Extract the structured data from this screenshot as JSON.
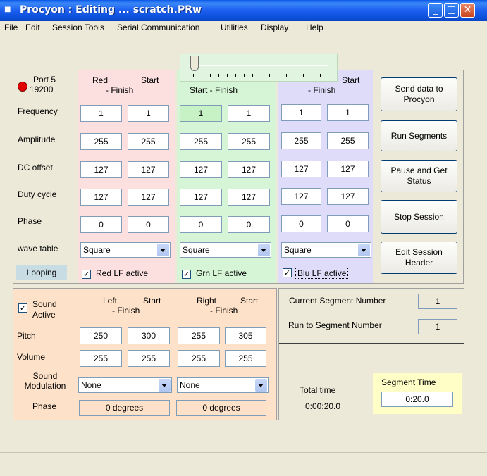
{
  "window": {
    "title": "Procyon : Editing ... scratch.PRw"
  },
  "menu": [
    "File",
    "Edit",
    "Session Tools",
    "Serial Communication",
    "Utilities",
    "Display",
    "Help"
  ],
  "colors": {
    "red": "#fce0e0",
    "green": "#d6f5d6",
    "blue": "#dedcf8",
    "orange": "#fde1c8",
    "yellow": "#fefec6",
    "looping": "#c8dce4",
    "titlebar": "#0a58e6"
  },
  "port": {
    "name": "Port 5",
    "baud": "19200"
  },
  "rows": {
    "frequency": "Frequency",
    "amplitude": "Amplitude",
    "dc_offset": "DC offset",
    "duty_cycle": "Duty cycle",
    "phase": "Phase",
    "wave_table": "wave table",
    "looping": "Looping"
  },
  "red": {
    "title": "Red",
    "start": "Start",
    "finish": "- Finish",
    "frequency": [
      "1",
      "1"
    ],
    "amplitude": [
      "255",
      "255"
    ],
    "dc_offset": [
      "127",
      "127"
    ],
    "duty_cycle": [
      "127",
      "127"
    ],
    "phase": [
      "0",
      "0"
    ],
    "wave": "Square",
    "lf_label": "Red LF active"
  },
  "green": {
    "header": "Start  -  Finish",
    "frequency": [
      "1",
      "1"
    ],
    "amplitude": [
      "255",
      "255"
    ],
    "dc_offset": [
      "127",
      "127"
    ],
    "duty_cycle": [
      "127",
      "127"
    ],
    "phase": [
      "0",
      "0"
    ],
    "wave": "Square",
    "lf_label": "Grn LF active"
  },
  "blue": {
    "start": "Start",
    "finish": "- Finish",
    "frequency": [
      "1",
      "1"
    ],
    "amplitude": [
      "255",
      "255"
    ],
    "dc_offset": [
      "127",
      "127"
    ],
    "duty_cycle": [
      "127",
      "127"
    ],
    "phase": [
      "0",
      "0"
    ],
    "wave": "Square",
    "lf_label": "Blu LF active"
  },
  "buttons": {
    "send": "Send data to Procyon",
    "run": "Run Segments",
    "pause": "Pause and Get Status",
    "stop": "Stop Session",
    "edit": "Edit Session Header"
  },
  "sound": {
    "active_label": "Sound Active",
    "left": "Left",
    "right": "Right",
    "start": "Start",
    "finish": "- Finish",
    "pitch_label": "Pitch",
    "volume_label": "Volume",
    "modulation_label": "Sound Modulation",
    "phase_label": "Phase",
    "left_pitch": [
      "250",
      "300"
    ],
    "right_pitch": [
      "255",
      "305"
    ],
    "left_volume": [
      "255",
      "255"
    ],
    "right_volume": [
      "255",
      "255"
    ],
    "left_mod": "None",
    "right_mod": "None",
    "left_phase": "0 degrees",
    "right_phase": "0 degrees"
  },
  "segment": {
    "current_label": "Current Segment Number",
    "current": "1",
    "run_to_label": "Run to Segment Number",
    "run_to": "1",
    "total_time_label": "Total time",
    "total_time": "0:00:20.0",
    "segment_time_label": "Segment Time",
    "segment_time": "0:20.0"
  }
}
